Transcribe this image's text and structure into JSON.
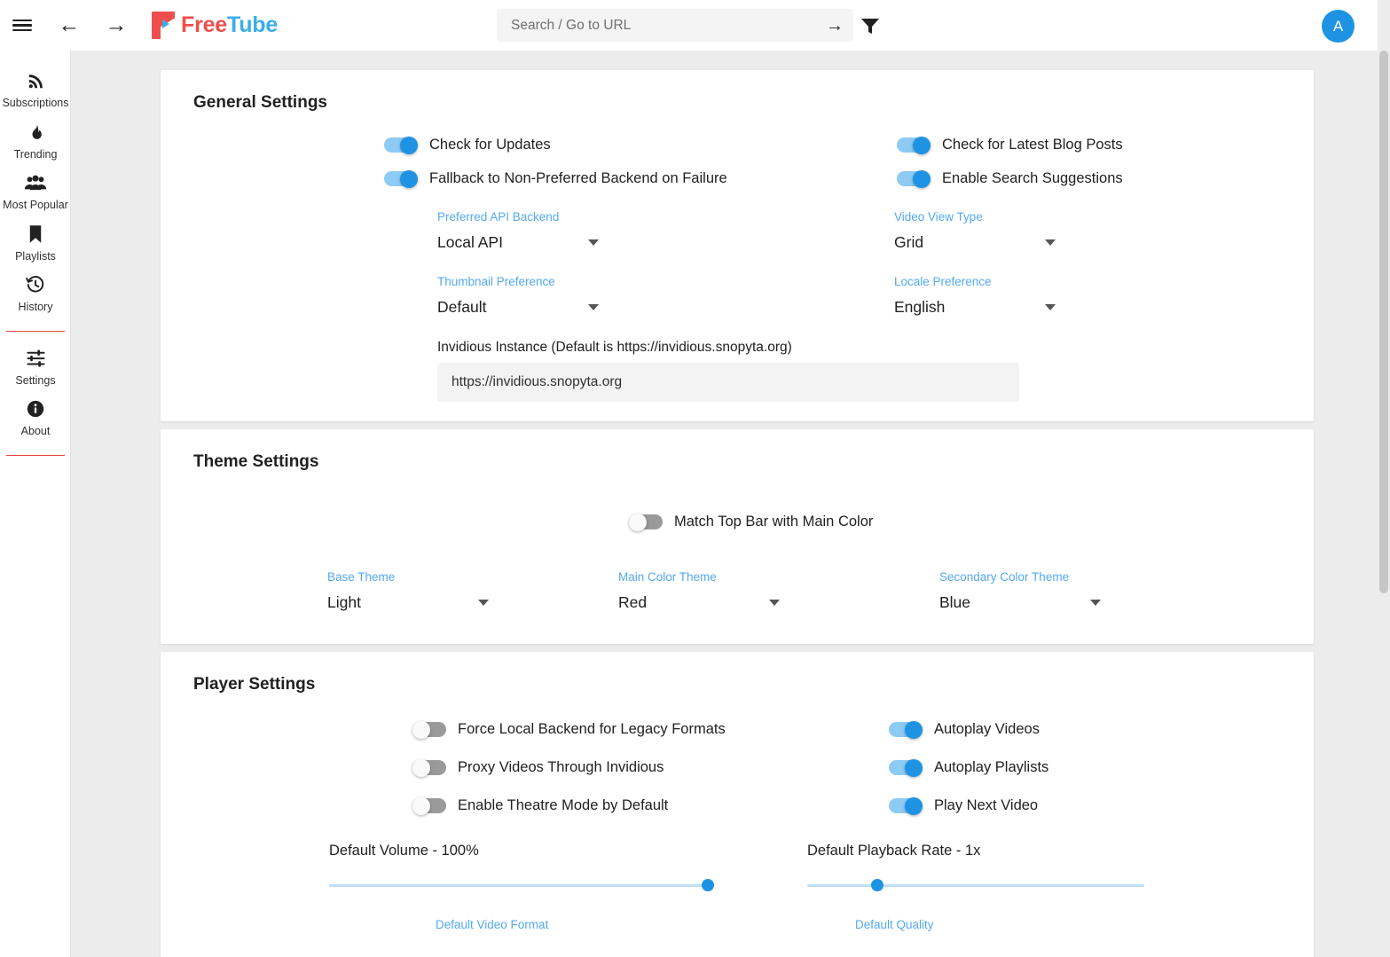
{
  "topbar": {
    "menu_icon": "hamburger-icon",
    "back_icon": "arrow-left-icon",
    "forward_icon": "arrow-right-icon",
    "brand_free": "Free",
    "brand_tube": "Tube",
    "search_placeholder": "Search / Go to URL",
    "search_value": "",
    "go_icon": "arrow-right-icon",
    "filter_icon": "filter-icon",
    "avatar_initial": "A",
    "avatar_color": "#1f93e3"
  },
  "sidebar": {
    "items": [
      {
        "label": "Subscriptions",
        "icon": "rss-icon"
      },
      {
        "label": "Trending",
        "icon": "flame-icon"
      },
      {
        "label": "Most Popular",
        "icon": "people-icon"
      },
      {
        "label": "Playlists",
        "icon": "bookmark-icon"
      },
      {
        "label": "History",
        "icon": "history-icon"
      },
      {
        "label": "Settings",
        "icon": "sliders-icon"
      },
      {
        "label": "About",
        "icon": "info-icon"
      }
    ],
    "divider_color": "#e04a3f"
  },
  "general_settings": {
    "title": "General Settings",
    "toggles": [
      {
        "label": "Check for Updates",
        "on": true
      },
      {
        "label": "Check for Latest Blog Posts",
        "on": true
      },
      {
        "label": "Fallback to Non-Preferred Backend on Failure",
        "on": true
      },
      {
        "label": "Enable Search Suggestions",
        "on": true
      }
    ],
    "selects": [
      {
        "label": "Preferred API Backend",
        "value": "Local API"
      },
      {
        "label": "Video View Type",
        "value": "Grid"
      },
      {
        "label": "Thumbnail Preference",
        "value": "Default"
      },
      {
        "label": "Locale Preference",
        "value": "English"
      }
    ],
    "invidious": {
      "label": "Invidious Instance (Default is https://invidious.snopyta.org)",
      "value": "https://invidious.snopyta.org"
    }
  },
  "theme_settings": {
    "title": "Theme Settings",
    "match_topbar": {
      "label": "Match Top Bar with Main Color",
      "on": false
    },
    "selects": [
      {
        "label": "Base Theme",
        "value": "Light"
      },
      {
        "label": "Main Color Theme",
        "value": "Red"
      },
      {
        "label": "Secondary Color Theme",
        "value": "Blue"
      }
    ]
  },
  "player_settings": {
    "title": "Player Settings",
    "toggles_left": [
      {
        "label": "Force Local Backend for Legacy Formats",
        "on": false
      },
      {
        "label": "Proxy Videos Through Invidious",
        "on": false
      },
      {
        "label": "Enable Theatre Mode by Default",
        "on": false
      }
    ],
    "toggles_right": [
      {
        "label": "Autoplay Videos",
        "on": true
      },
      {
        "label": "Autoplay Playlists",
        "on": true
      },
      {
        "label": "Play Next Video",
        "on": true
      }
    ],
    "volume": {
      "label": "Default Volume - 100%",
      "percent": 100
    },
    "playback_rate": {
      "label": "Default Playback Rate - 1x",
      "percent": 19
    },
    "format_label": "Default Video Format",
    "quality_label": "Default Quality"
  }
}
